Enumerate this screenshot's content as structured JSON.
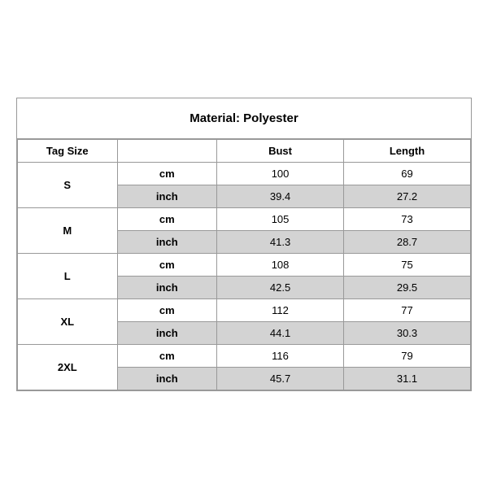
{
  "title": "Material: Polyester",
  "headers": {
    "tag_size": "Tag Size",
    "bust": "Bust",
    "length": "Length"
  },
  "sizes": [
    {
      "tag": "S",
      "cm": {
        "bust": "100",
        "length": "69"
      },
      "inch": {
        "bust": "39.4",
        "length": "27.2"
      }
    },
    {
      "tag": "M",
      "cm": {
        "bust": "105",
        "length": "73"
      },
      "inch": {
        "bust": "41.3",
        "length": "28.7"
      }
    },
    {
      "tag": "L",
      "cm": {
        "bust": "108",
        "length": "75"
      },
      "inch": {
        "bust": "42.5",
        "length": "29.5"
      }
    },
    {
      "tag": "XL",
      "cm": {
        "bust": "112",
        "length": "77"
      },
      "inch": {
        "bust": "44.1",
        "length": "30.3"
      }
    },
    {
      "tag": "2XL",
      "cm": {
        "bust": "116",
        "length": "79"
      },
      "inch": {
        "bust": "45.7",
        "length": "31.1"
      }
    }
  ],
  "labels": {
    "cm": "cm",
    "inch": "inch"
  }
}
